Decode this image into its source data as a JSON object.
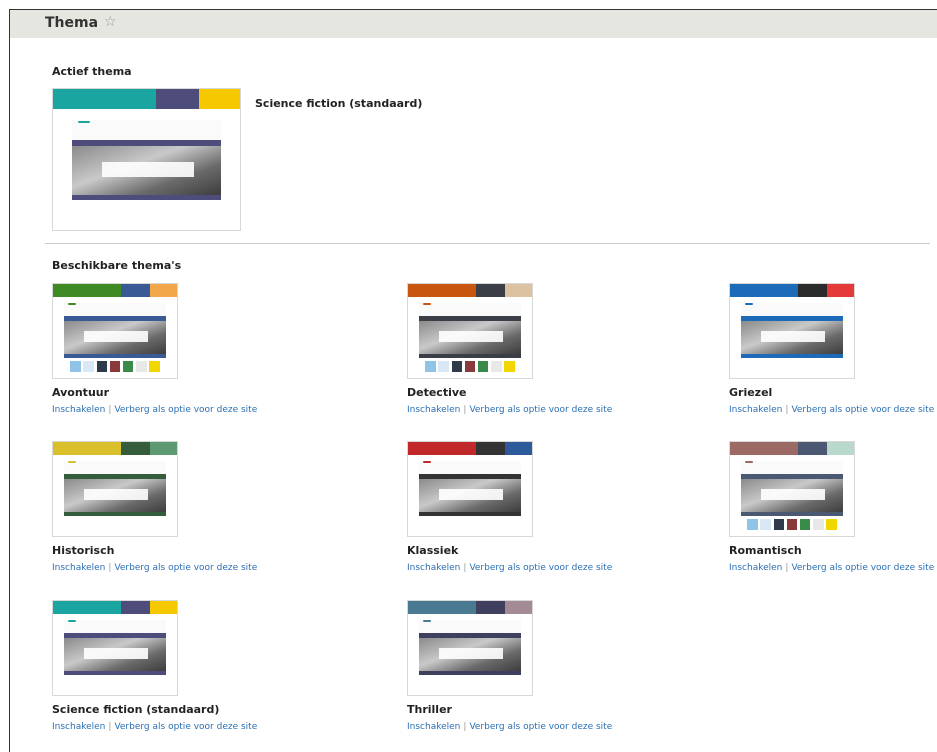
{
  "page": {
    "title": "Thema",
    "star": "☆",
    "active_heading": "Actief thema",
    "available_heading": "Beschikbare thema's"
  },
  "active_theme": {
    "name": "Science fiction (standaard)",
    "colors": [
      "#1aa5a0",
      "#4e4c7a",
      "#f5c800"
    ]
  },
  "links": {
    "enable": "Inschakelen",
    "separator": "|",
    "hide": "Verberg als optie voor deze site"
  },
  "themes": [
    {
      "name": "Avontuur",
      "colors": [
        "#3f8a25",
        "#3a5a95",
        "#f2a74a"
      ],
      "nav": "#3a5a95",
      "books": true
    },
    {
      "name": "Detective",
      "colors": [
        "#c8560f",
        "#3b3e46",
        "#dcc2a0"
      ],
      "nav": "#3b3e46",
      "books": true
    },
    {
      "name": "Griezel",
      "colors": [
        "#1c6ab8",
        "#2b2b2b",
        "#e53a3a"
      ],
      "nav": "#1c6ab8",
      "books": false
    },
    {
      "name": "Historisch",
      "colors": [
        "#d9c02a",
        "#355d3c",
        "#5d9a72"
      ],
      "nav": "#355d3c",
      "books": false
    },
    {
      "name": "Klassiek",
      "colors": [
        "#c0282a",
        "#333333",
        "#2c5a9a"
      ],
      "nav": "#333333",
      "books": false
    },
    {
      "name": "Romantisch",
      "colors": [
        "#9b6a64",
        "#4a5872",
        "#b9d9cd"
      ],
      "nav": "#4a5872",
      "books": true
    },
    {
      "name": "Science fiction (standaard)",
      "colors": [
        "#1aa5a0",
        "#4e4c7a",
        "#f5c800"
      ],
      "nav": "#4e4c7a",
      "books": false
    },
    {
      "name": "Thriller",
      "colors": [
        "#4a7a92",
        "#3f3f5e",
        "#a48a95"
      ],
      "nav": "#3f3f5e",
      "books": false
    }
  ]
}
